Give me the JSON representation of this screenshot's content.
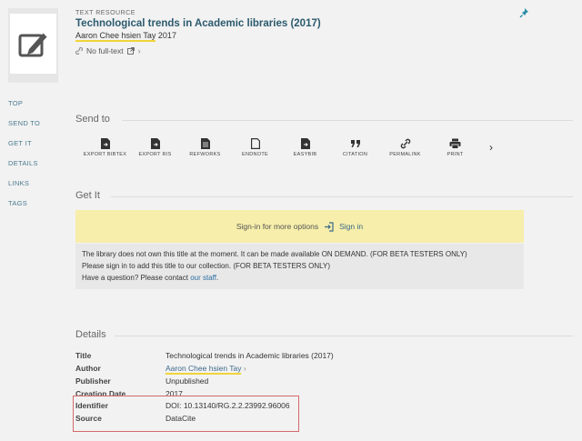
{
  "record": {
    "resource_type": "TEXT RESOURCE",
    "title": "Technological trends in Academic libraries (2017)",
    "author": "Aaron Chee hsien Tay",
    "year": "2017",
    "availability": "No full-text"
  },
  "sidenav": [
    "TOP",
    "SEND TO",
    "GET IT",
    "DETAILS",
    "LINKS",
    "TAGS"
  ],
  "send_to": {
    "heading": "Send to",
    "items": [
      {
        "label": "EXPORT BIBTEX",
        "icon": "file-export-icon"
      },
      {
        "label": "EXPORT RIS",
        "icon": "file-export-icon"
      },
      {
        "label": "REFWORKS",
        "icon": "file-text-icon"
      },
      {
        "label": "ENDNOTE",
        "icon": "file-icon"
      },
      {
        "label": "EASYBIB",
        "icon": "file-export-icon"
      },
      {
        "label": "CITATION",
        "icon": "quote-icon"
      },
      {
        "label": "PERMALINK",
        "icon": "link-icon"
      },
      {
        "label": "PRINT",
        "icon": "printer-icon"
      }
    ]
  },
  "get_it": {
    "heading": "Get It",
    "signin_prefix": "Sign-in for more options",
    "signin_link": "Sign in",
    "line1": "The library does not own this title at the moment. It can be made available ON DEMAND. (FOR BETA TESTERS ONLY)",
    "line2": "Please sign in to add this title to our collection. (FOR BETA TESTERS ONLY)",
    "line3_prefix": "Have a question? Please contact ",
    "line3_link": "our staff",
    "line3_suffix": "."
  },
  "details": {
    "heading": "Details",
    "rows": [
      {
        "key": "Title",
        "value": "Technological trends in Academic libraries (2017)"
      },
      {
        "key": "Author",
        "value": "Aaron Chee hsien Tay"
      },
      {
        "key": "Publisher",
        "value": "Unpublished"
      },
      {
        "key": "Creation Date",
        "value": "2017"
      },
      {
        "key": "Identifier",
        "value": "DOI: 10.13140/RG.2.2.23992.96006"
      },
      {
        "key": "Source",
        "value": "DataCite"
      }
    ]
  },
  "colors": {
    "accent": "#2b5a6e",
    "highlight": "#f1d439",
    "signin_bg": "#f6eeaa",
    "annotation_box": "#d46a6a"
  }
}
